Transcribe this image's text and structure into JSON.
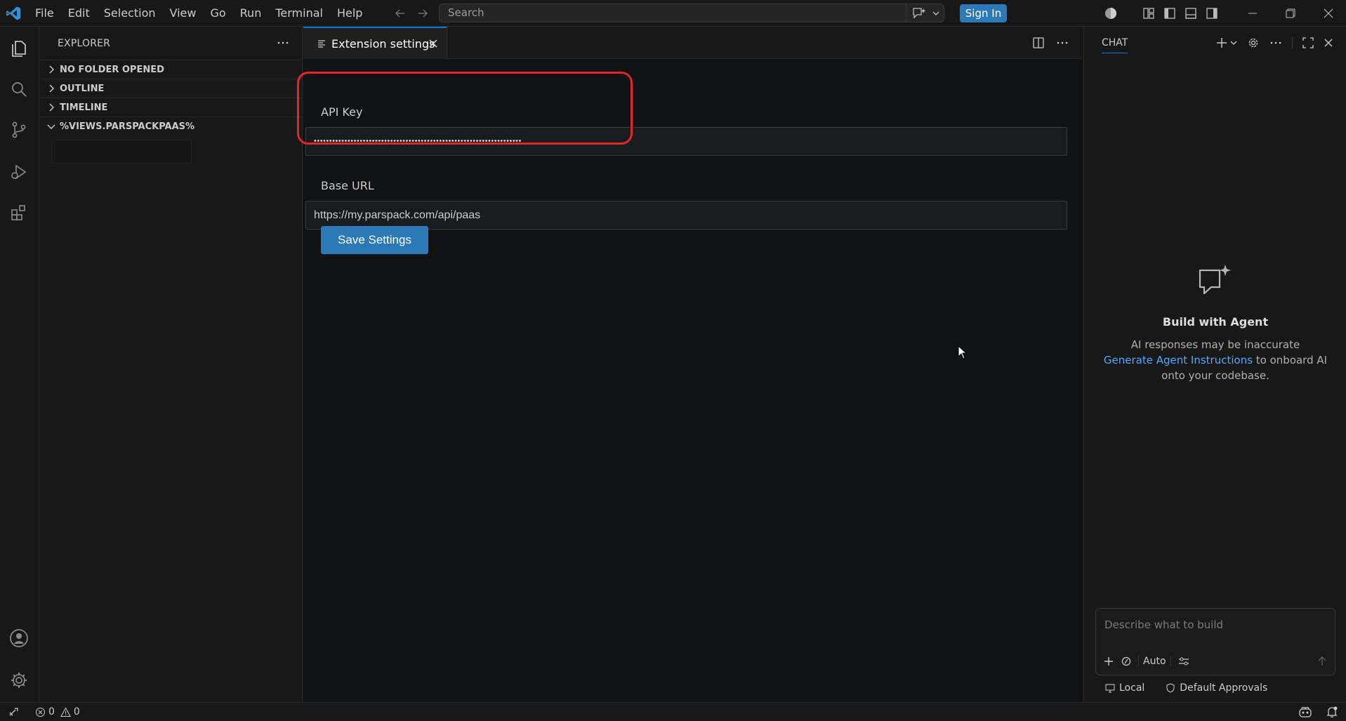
{
  "titlebar": {
    "menu": [
      "File",
      "Edit",
      "Selection",
      "View",
      "Go",
      "Run",
      "Terminal",
      "Help"
    ],
    "search_placeholder": "Search",
    "signin_label": "Sign In"
  },
  "sidebar": {
    "header": "EXPLORER",
    "sections": [
      {
        "label": "NO FOLDER OPENED",
        "expanded": false
      },
      {
        "label": "OUTLINE",
        "expanded": false
      },
      {
        "label": "TIMELINE",
        "expanded": false
      },
      {
        "label": "%VIEWS.PARSPACKPAAS%",
        "expanded": true
      }
    ]
  },
  "editor": {
    "tab_label": "Extension settings",
    "api_key_label": "API Key",
    "api_key_value": "••••••••••••••••••••••••••••••••••••••••••••••••••••••••••••••••••••",
    "base_url_label": "Base URL",
    "base_url_value": "https://my.parspack.com/api/paas",
    "save_label": "Save Settings",
    "highlight_color": "#e32626"
  },
  "chat": {
    "title": "CHAT",
    "empty_title": "Build with Agent",
    "empty_line1": "AI responses may be inaccurate",
    "empty_link": "Generate Agent Instructions",
    "empty_line2_rest": " to onboard AI",
    "empty_line3": "onto your codebase.",
    "input_placeholder": "Describe what to build",
    "mode_label": "Auto",
    "footer_local": "Local",
    "footer_approvals": "Default Approvals"
  },
  "statusbar": {
    "errors": "0",
    "warnings": "0"
  },
  "colors": {
    "accent": "#0078d4",
    "button": "#2b79b7",
    "link": "#4daafc"
  }
}
